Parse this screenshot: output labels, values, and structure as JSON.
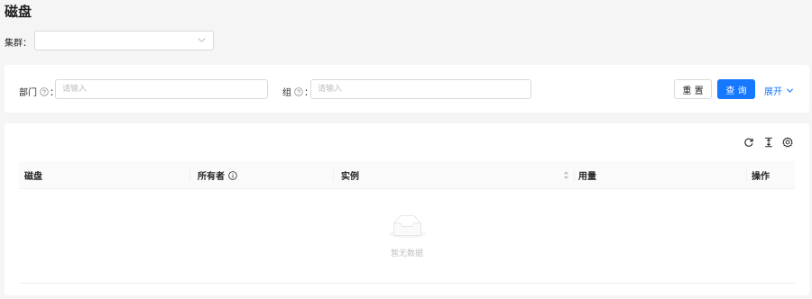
{
  "page": {
    "title": "磁盘"
  },
  "cluster": {
    "label": "集群：",
    "value": ""
  },
  "search": {
    "department_label": "部门",
    "department_placeholder": "请输入",
    "department_value": "",
    "group_label": "组",
    "group_placeholder": "请输入",
    "group_value": "",
    "colon": "：",
    "reset_label": "重 置",
    "query_label": "查 询",
    "expand_label": "展开"
  },
  "toolbar": {
    "icons": [
      "reload-icon",
      "column-height-icon",
      "setting-icon"
    ]
  },
  "table": {
    "columns": [
      "磁盘",
      "所有者",
      "实例",
      "用量",
      "操作"
    ],
    "rows": [],
    "empty_text": "暂无数据"
  },
  "colors": {
    "primary": "#1677ff",
    "border": "#d9d9d9",
    "header_bg": "#fafafa",
    "placeholder": "#bfbfbf"
  }
}
